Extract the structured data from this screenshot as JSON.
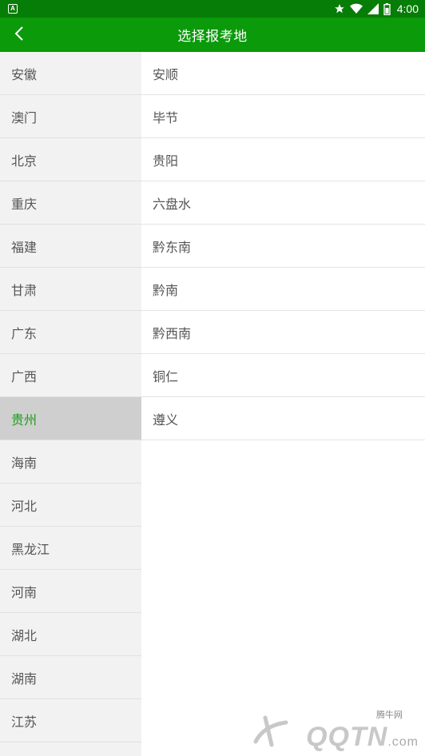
{
  "status_bar": {
    "time": "4:00",
    "icons": [
      "app-badge-icon",
      "star-icon",
      "wifi-icon",
      "signal-icon",
      "battery-icon"
    ],
    "background": "#067d06"
  },
  "app_bar": {
    "title": "选择报考地",
    "back_icon": "chevron-left-icon",
    "background": "#0a9a0a"
  },
  "provinces": [
    {
      "label": "安徽"
    },
    {
      "label": "澳门"
    },
    {
      "label": "北京"
    },
    {
      "label": "重庆"
    },
    {
      "label": "福建"
    },
    {
      "label": "甘肃"
    },
    {
      "label": "广东"
    },
    {
      "label": "广西"
    },
    {
      "label": "贵州",
      "selected": true
    },
    {
      "label": "海南"
    },
    {
      "label": "河北"
    },
    {
      "label": "黑龙江"
    },
    {
      "label": "河南"
    },
    {
      "label": "湖北"
    },
    {
      "label": "湖南"
    },
    {
      "label": "江苏"
    }
  ],
  "cities": [
    {
      "label": "安顺"
    },
    {
      "label": "毕节"
    },
    {
      "label": "贵阳"
    },
    {
      "label": "六盘水"
    },
    {
      "label": "黔东南"
    },
    {
      "label": "黔南"
    },
    {
      "label": "黔西南"
    },
    {
      "label": "铜仁"
    },
    {
      "label": "遵义"
    }
  ],
  "selected_color": "#169c16",
  "watermark": {
    "small_text": "腾牛网",
    "main_text": "QQTN",
    "suffix": ".com"
  }
}
